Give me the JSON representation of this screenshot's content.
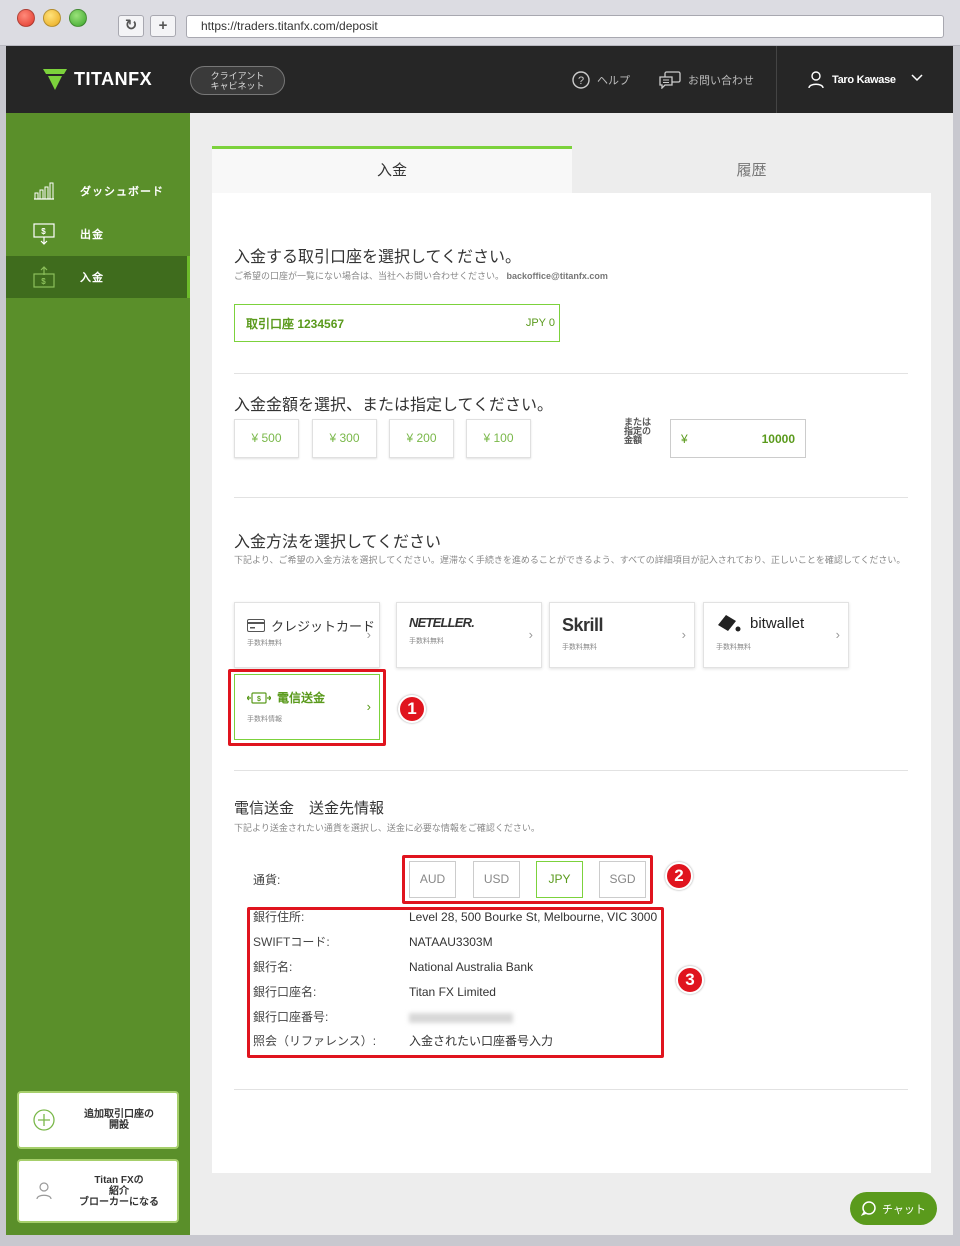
{
  "browser": {
    "url": "https://traders.titanfx.com/deposit",
    "reload_glyph": "↻",
    "newtab_glyph": "+"
  },
  "header": {
    "logo_text": "TITANFX",
    "client_cabinet": "クライアント\nキャビネット",
    "help": "ヘルプ",
    "contact": "お問い合わせ",
    "user_name": "Taro Kawase"
  },
  "sidebar": {
    "items": [
      {
        "label": "ダッシュボード",
        "icon": "bar-chart-icon"
      },
      {
        "label": "出金",
        "icon": "withdraw-icon"
      },
      {
        "label": "入金",
        "icon": "deposit-icon"
      }
    ],
    "open_account": "追加取引口座の\n開設",
    "become_broker": "Titan FXの\n紹介\nブローカーになる"
  },
  "tabs": {
    "deposit": "入金",
    "history": "履歴"
  },
  "account_section": {
    "title": "入金する取引口座を選択してください。",
    "subtitle": "ご希望の口座が一覧にない場合は、当社へお問い合わせください。",
    "email": "backoffice@titanfx.com",
    "account_label": "取引口座 1234567",
    "balance": "JPY 0"
  },
  "amount_section": {
    "title": "入金金額を選択、または指定してください。",
    "presets": [
      "¥ 500",
      "¥ 300",
      "¥ 200",
      "¥ 100"
    ],
    "or_label": "または\n指定の\n金額",
    "currency_symbol": "¥",
    "amount_value": "10000"
  },
  "method_section": {
    "title": "入金方法を選択してください",
    "subtitle": "下記より、ご希望の入金方法を選択してください。遅滞なく手続きを進めることができるよう、すべての詳細項目が記入されており、正しいことを確認してください。",
    "methods": [
      {
        "name": "クレジットカード",
        "fee": "手数料無料"
      },
      {
        "name": "NETELLER.",
        "fee": "手数料無料"
      },
      {
        "name": "Skrill",
        "fee": "手数料無料"
      },
      {
        "name": "bitwallet",
        "fee": "手数料無料"
      },
      {
        "name": "電信送金",
        "fee": "手数料情報"
      }
    ]
  },
  "wire_section": {
    "title": "電信送金　送金先情報",
    "subtitle": "下記より送金されたい通貨を選択し、送金に必要な情報をご確認ください。",
    "currency_label": "通貨:",
    "currencies": [
      "AUD",
      "USD",
      "JPY",
      "SGD"
    ],
    "selected_currency": "JPY",
    "rows": [
      {
        "label": "銀行住所:",
        "value": "Level 28, 500 Bourke St, Melbourne, VIC 3000"
      },
      {
        "label": "SWIFTコード:",
        "value": "NATAAU3303M"
      },
      {
        "label": "銀行名:",
        "value": "National Australia Bank"
      },
      {
        "label": "銀行口座名:",
        "value": "Titan FX Limited"
      },
      {
        "label": "銀行口座番号:",
        "value": ""
      },
      {
        "label": "照会（リファレンス）:",
        "value": "入金されたい口座番号入力"
      }
    ]
  },
  "annotations": [
    "1",
    "2",
    "3"
  ],
  "chat": "チャット",
  "colors": {
    "brand_green": "#5a8f2a",
    "accent_green": "#7cd23c",
    "annotation_red": "#e0141e",
    "nav_dark": "#262626"
  }
}
